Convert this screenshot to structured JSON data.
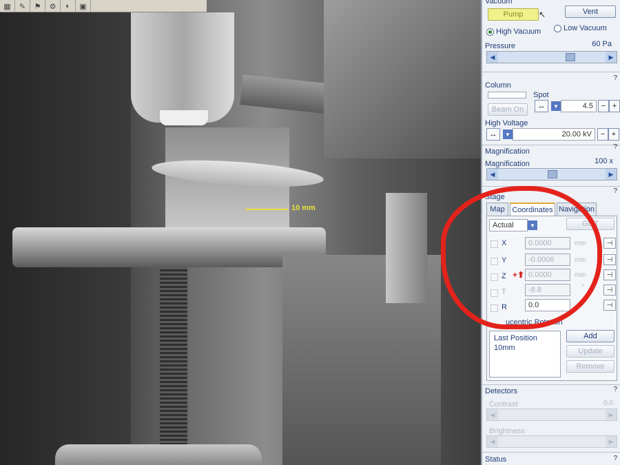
{
  "camera": {
    "scale_label": "10 mm"
  },
  "vacuum": {
    "title": "Vacuum",
    "pump_label": "Pump",
    "vent_label": "Vent",
    "mode_high": "High Vacuum",
    "mode_low": "Low Vacuum",
    "selected_mode": "High Vacuum",
    "pressure_label": "Pressure",
    "pressure_value": "60 Pa"
  },
  "column": {
    "title": "Column",
    "spot_label": "Spot",
    "beam_on_label": "Beam On",
    "spot_value": "4.5",
    "hv_label": "High Voltage",
    "hv_value": "20.00 kV"
  },
  "magnification": {
    "title": "Magnification",
    "label": "Magnification",
    "value": "100 x"
  },
  "stage": {
    "title": "Stage",
    "tabs": [
      "Map",
      "Coordinates",
      "Navigation"
    ],
    "active_tab": "Coordinates",
    "mode_value": "Actual",
    "goto_label": "Go T",
    "coords": [
      {
        "axis": "X",
        "value": "0.0000",
        "unit": "mm"
      },
      {
        "axis": "Y",
        "value": "-0.0006",
        "unit": "mm"
      },
      {
        "axis": "Z",
        "value": "0.0000",
        "unit": "mm"
      },
      {
        "axis": "T",
        "value": "-8.8",
        "unit": "°"
      },
      {
        "axis": "R",
        "value": "0.0",
        "unit": "°"
      }
    ],
    "eucentric_label": "ucentric Rotation",
    "positions": [
      "Last Position",
      "10mm"
    ],
    "add_label": "Add",
    "update_label": "Update",
    "remove_label": "Remove"
  },
  "detectors": {
    "title": "Detectors",
    "contrast_label": "Contrast",
    "contrast_value": "0.0",
    "brightness_label": "Brightness"
  },
  "status": {
    "title": "Status"
  },
  "colors": {
    "annotation": "#e3231b",
    "pump_button": "#f0f18a",
    "scale_bar": "#e8e23c",
    "panel_text": "#1e3c78"
  },
  "help_mark": "?"
}
